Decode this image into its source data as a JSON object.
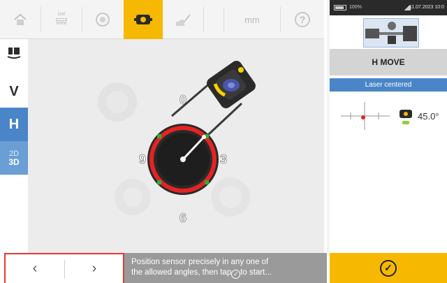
{
  "toolbar": {
    "items": [
      {
        "name": "home-icon"
      },
      {
        "name": "dimensions-icon",
        "label_top": "DIM",
        "label_bottom": "MMM"
      },
      {
        "name": "measure-icon"
      },
      {
        "name": "sensor-icon",
        "active": true
      },
      {
        "name": "results-icon"
      },
      {
        "name": "units",
        "label": "mm"
      },
      {
        "name": "help-icon",
        "label": "?"
      }
    ],
    "active_color": "#f6b800"
  },
  "sidebar": {
    "items": [
      {
        "name": "machine-view-icon"
      },
      {
        "name": "vertical",
        "label": "V"
      },
      {
        "name": "horizontal",
        "label": "H",
        "active": true
      },
      {
        "name": "view-mode",
        "label_top": "2D",
        "label_bottom": "3D"
      }
    ],
    "accent": "#4a86c7"
  },
  "dial": {
    "labels": {
      "top": "0",
      "left": "9",
      "right": "3",
      "bottom": "6"
    },
    "ring_color": "#e52323",
    "marker_color": "#2fae3a"
  },
  "status_bar": {
    "battery": "100%",
    "datetime": "11.07.2023 10:0"
  },
  "right_panel": {
    "title": "H MOVE",
    "laser_status": "Laser centered",
    "angle": "45.0°"
  },
  "bottom": {
    "prev_label": "‹",
    "next_label": "›",
    "instruction_line1": "Position sensor precisely in any one of",
    "instruction_line2_pre": "the allowed angles, then tap",
    "instruction_line2_post": "to start...",
    "confirm_icon": "check-circle-icon"
  }
}
